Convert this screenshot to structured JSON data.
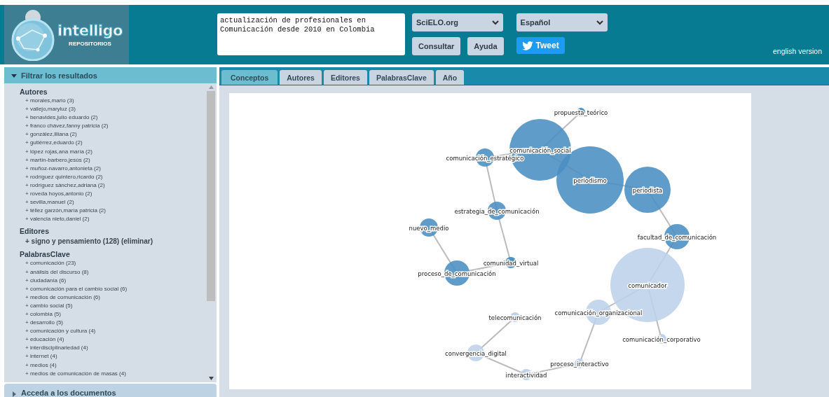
{
  "logo": {
    "name": "intelligo",
    "subtitle": "REPOSITORIOS"
  },
  "search": {
    "value": "actualización de profesionales en Comunicación desde 2010 en Colombia"
  },
  "source_select": {
    "value": "SciELO.org"
  },
  "language_select": {
    "value": "Español"
  },
  "buttons": [
    "Consultar",
    "Ayuda"
  ],
  "tweet_button": {
    "label": "Tweet"
  },
  "english_link": "english version",
  "filter_panel": {
    "title": "Filtrar los resultados",
    "expanded": true,
    "groups": [
      {
        "title": "Autores",
        "kind": "list",
        "items": [
          "+ morales,mario (3)",
          "+ vallejo,maryluz (3)",
          "+ benavides,julio eduardo (2)",
          "+ franco chávez,fanny patricia (2)",
          "+ gonzález,liliana (2)",
          "+ gutiérrez,eduardo (2)",
          "+ lópez rojas,ana maría (2)",
          "+ martín-barbero,jesús (2)",
          "+ muñoz-navarro,antonieta (2)",
          "+ rodríguez quintero,ricardo (2)",
          "+ rodríguez sánchez,adriana (2)",
          "+ roveda hoyos,antonio (2)",
          "+ sevilla,manuel (2)",
          "+ téllez garzón,maría patricia (2)",
          "+ valencia nieto,daniel (2)"
        ]
      },
      {
        "title": "Editores",
        "kind": "applied",
        "items": [
          "+ signo y pensamiento (128) (eliminar)"
        ]
      },
      {
        "title": "PalabrasClave",
        "kind": "list",
        "items": [
          "+ comunicación (23)",
          "+ análisis del discurso (8)",
          "+ ciudadanía (6)",
          "+ comunicación para el cambio social (6)",
          "+ medios de comunicación (6)",
          "+ cambio social (5)",
          "+ colombia (5)",
          "+ desarrollo (5)",
          "+ comunicación y cultura (4)",
          "+ educación (4)",
          "+ interdisciplinariedad (4)",
          "+ internet (4)",
          "+ medios (4)",
          "+ medios de comunicación de masas (4)"
        ]
      }
    ]
  },
  "documents_panel": {
    "title": "Acceda a los documentos",
    "expanded": false
  },
  "tabs": [
    {
      "label": "Conceptos",
      "selected": true
    },
    {
      "label": "Autores",
      "selected": false
    },
    {
      "label": "Editores",
      "selected": false
    },
    {
      "label": "PalabrasClave",
      "selected": false
    },
    {
      "label": "Año",
      "selected": false
    }
  ],
  "graph": {
    "nodes": [
      {
        "label": "propuesta_teórico",
        "color": "#4a8ec2"
      },
      {
        "label": "comunicación_social",
        "color": "#4a8ec2"
      },
      {
        "label": "comunicación_estratégico",
        "color": "#4a8ec2"
      },
      {
        "label": "periodismo",
        "color": "#4a8ec2"
      },
      {
        "label": "periodista",
        "color": "#4a8ec2"
      },
      {
        "label": "estrategia_de_comunicación",
        "color": "#4a8ec2"
      },
      {
        "label": "nuevo_medio",
        "color": "#4a8ec2"
      },
      {
        "label": "facultad_de_comunicación",
        "color": "#4a8ec2"
      },
      {
        "label": "comunidad_virtual",
        "color": "#4a8ec2"
      },
      {
        "label": "proceso_de_comunicación",
        "color": "#4a8ec2"
      },
      {
        "label": "comunicador",
        "color": "#bdd1ea"
      },
      {
        "label": "comunicación_organizacional",
        "color": "#bdd1ea"
      },
      {
        "label": "telecomunicación",
        "color": "#bdd1ea"
      },
      {
        "label": "comunicación_corporativo",
        "color": "#bdd1ea"
      },
      {
        "label": "convergencia_digital",
        "color": "#bdd1ea"
      },
      {
        "label": "proceso_interactivo",
        "color": "#bdd1ea"
      },
      {
        "label": "interactividad",
        "color": "#bdd1ea"
      }
    ]
  }
}
